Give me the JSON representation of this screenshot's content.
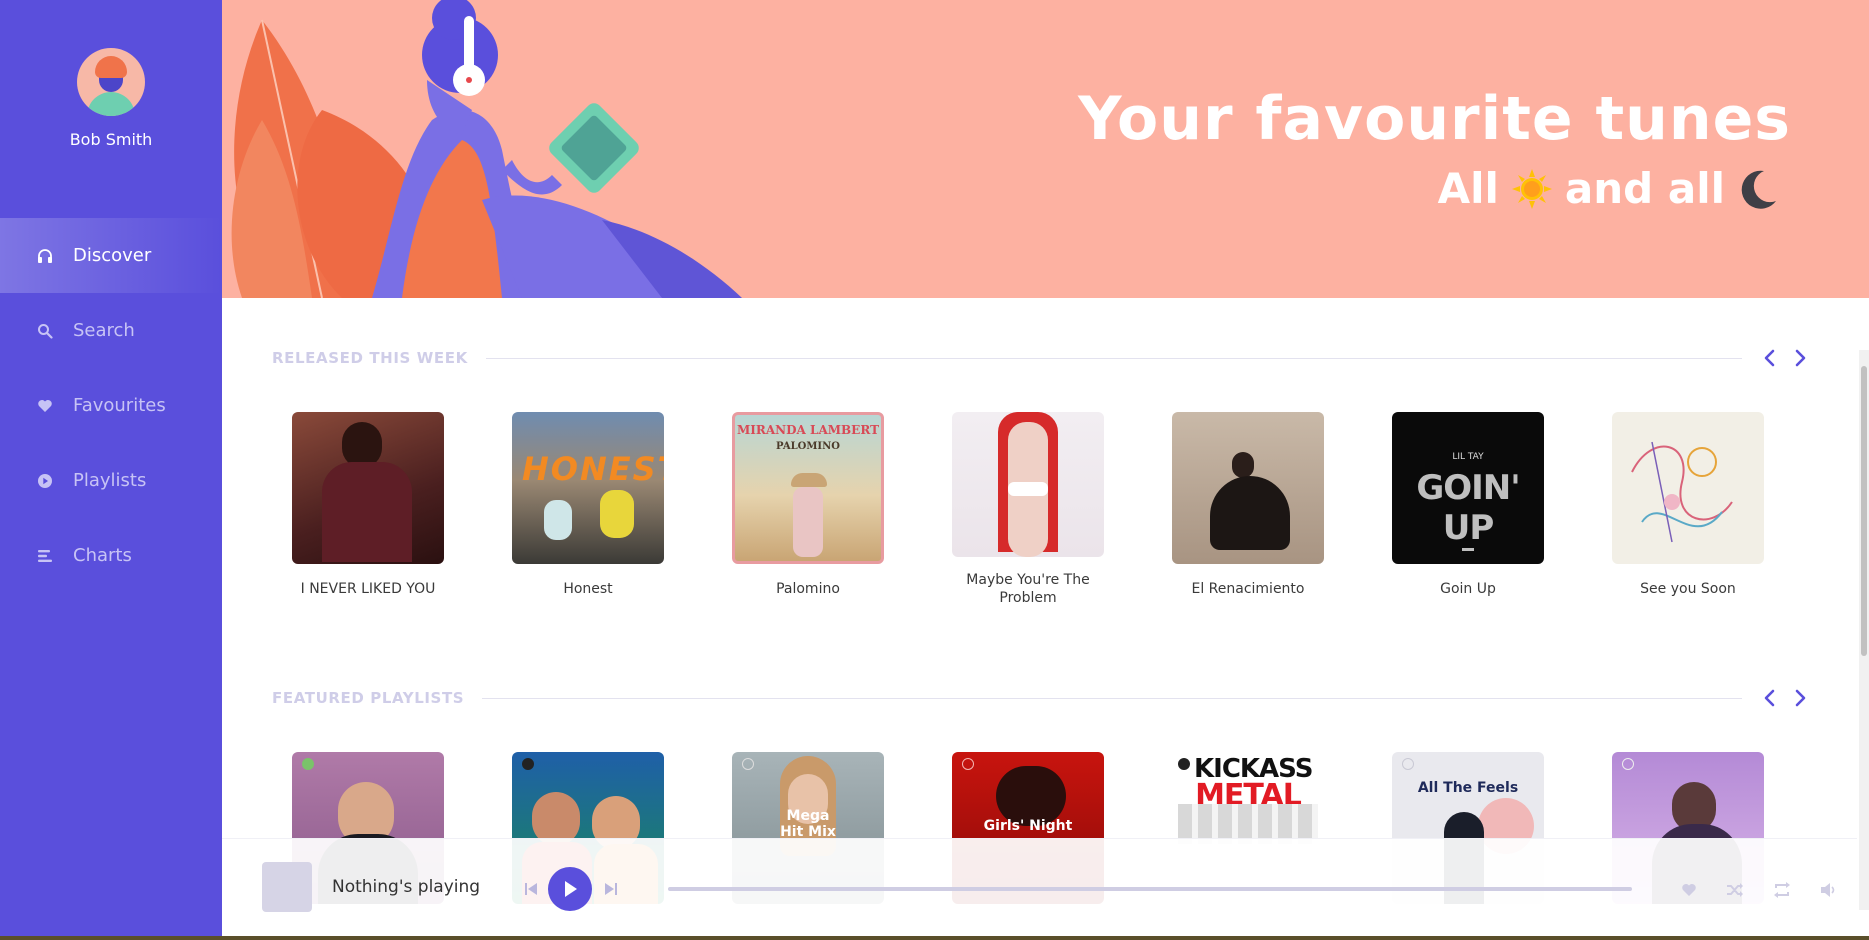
{
  "user": {
    "name": "Bob Smith"
  },
  "nav": {
    "items": [
      {
        "label": "Discover",
        "icon": "headphones-icon",
        "active": true
      },
      {
        "label": "Search",
        "icon": "search-icon",
        "active": false
      },
      {
        "label": "Favourites",
        "icon": "heart-icon",
        "active": false
      },
      {
        "label": "Playlists",
        "icon": "play-circle-icon",
        "active": false
      },
      {
        "label": "Charts",
        "icon": "bars-icon",
        "active": false
      }
    ]
  },
  "hero": {
    "title": "Your favourite tunes",
    "sub_part1": "All",
    "sub_part2": "and all",
    "sun": "☀",
    "moon": "☾"
  },
  "released": {
    "title": "RELEASED THIS WEEK",
    "albums": [
      {
        "title": "I NEVER LIKED YOU"
      },
      {
        "title": "Honest",
        "cover_text": "HONEST"
      },
      {
        "title": "Palomino",
        "cover_text": "MIRANDA LAMBERT",
        "cover_text2": "PALOMINO"
      },
      {
        "title": "Maybe You're The Problem"
      },
      {
        "title": "El Renacimiento"
      },
      {
        "title": "Goin Up",
        "cover_text": "LIL TAY",
        "cover_text2": "GOIN' UP"
      },
      {
        "title": "See you Soon"
      }
    ]
  },
  "featured": {
    "title": "FEATURED PLAYLISTS",
    "playlists": [
      {
        "cover_text": ""
      },
      {
        "cover_text": ""
      },
      {
        "cover_text": "Mega Hit Mix"
      },
      {
        "cover_text": "Girls' Night"
      },
      {
        "cover_text": "KICKASS",
        "cover_text2": "METAL"
      },
      {
        "cover_text": "All The Feels"
      },
      {
        "cover_text": ""
      }
    ]
  },
  "player": {
    "title": "Nothing's playing"
  },
  "colors": {
    "accent": "#5a4fdc",
    "hero": "#fdb1a1"
  }
}
